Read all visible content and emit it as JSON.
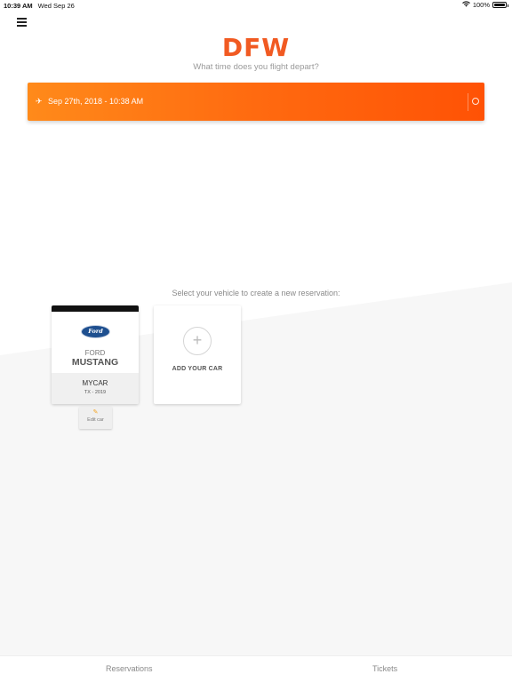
{
  "status_bar": {
    "time": "10:39 AM",
    "date": "Wed Sep 26",
    "battery": "100%"
  },
  "header": {
    "logo": "DFW",
    "subtitle": "What time does you flight depart?"
  },
  "departure": {
    "datetime": "Sep 27th, 2018 - 10:38 AM",
    "plane_icon": "plane-departure-icon",
    "clock_icon": "clock-icon"
  },
  "vehicles": {
    "prompt": "Select your vehicle to create a new reservation:",
    "cars": [
      {
        "brand_logo": "Ford",
        "make": "FORD",
        "model": "MUSTANG",
        "name": "MYCAR",
        "plate": "TX - 2019",
        "edit_label": "Edit car"
      }
    ],
    "add_label": "ADD YOUR CAR",
    "add_icon": "+"
  },
  "tabs": [
    {
      "label": "Reservations"
    },
    {
      "label": "Tickets"
    }
  ],
  "colors": {
    "brand": "#f15a22",
    "bar_start": "#ff8a1a",
    "bar_end": "#ff5205"
  }
}
